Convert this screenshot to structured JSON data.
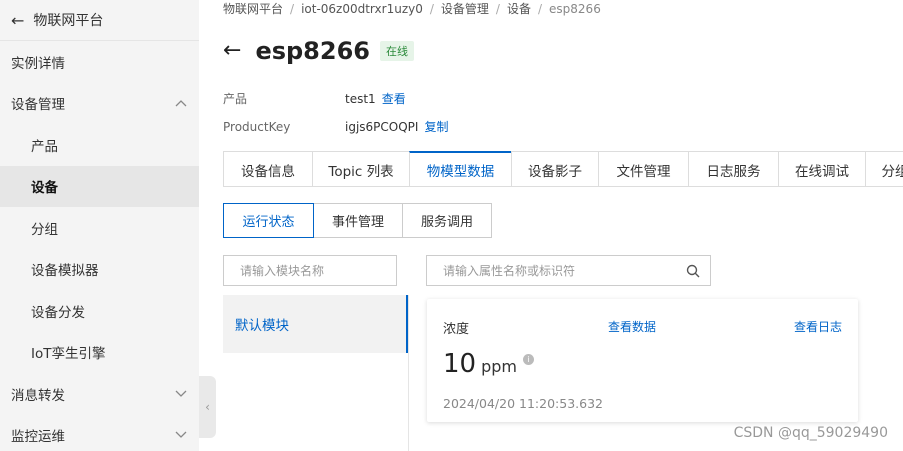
{
  "sidebar": {
    "header": "物联网平台",
    "items": [
      {
        "label": "实例详情",
        "sub": false,
        "active": false,
        "chevron": ""
      },
      {
        "label": "设备管理",
        "sub": false,
        "active": false,
        "chevron": "up"
      },
      {
        "label": "产品",
        "sub": true,
        "active": false,
        "chevron": ""
      },
      {
        "label": "设备",
        "sub": true,
        "active": true,
        "chevron": ""
      },
      {
        "label": "分组",
        "sub": true,
        "active": false,
        "chevron": ""
      },
      {
        "label": "设备模拟器",
        "sub": true,
        "active": false,
        "chevron": ""
      },
      {
        "label": "设备分发",
        "sub": true,
        "active": false,
        "chevron": ""
      },
      {
        "label": "IoT孪生引擎",
        "sub": true,
        "active": false,
        "chevron": ""
      },
      {
        "label": "消息转发",
        "sub": false,
        "active": false,
        "chevron": "down"
      },
      {
        "label": "监控运维",
        "sub": false,
        "active": false,
        "chevron": "down"
      }
    ]
  },
  "breadcrumb": [
    "物联网平台",
    "iot-06z00dtrxr1uzy0",
    "设备管理",
    "设备",
    "esp8266"
  ],
  "device": {
    "name": "esp8266",
    "status": "在线"
  },
  "meta": {
    "product_key_label": "产品",
    "product_value": "test1",
    "product_link": "查看",
    "pk_key_label": "ProductKey",
    "pk_value": "igjs6PCOQPI",
    "pk_link": "复制"
  },
  "tabs": [
    {
      "label": "设备信息",
      "active": false
    },
    {
      "label": "Topic 列表",
      "active": false
    },
    {
      "label": "物模型数据",
      "active": true
    },
    {
      "label": "设备影子",
      "active": false
    },
    {
      "label": "文件管理",
      "active": false
    },
    {
      "label": "日志服务",
      "active": false
    },
    {
      "label": "在线调试",
      "active": false
    },
    {
      "label": "分组",
      "active": false
    }
  ],
  "subtabs": [
    {
      "label": "运行状态",
      "active": true
    },
    {
      "label": "事件管理",
      "active": false
    },
    {
      "label": "服务调用",
      "active": false
    }
  ],
  "module_search": {
    "placeholder": "请输入模块名称"
  },
  "property_search": {
    "placeholder": "请输入属性名称或标识符"
  },
  "modules": [
    {
      "label": "默认模块",
      "active": true
    }
  ],
  "property_card": {
    "name": "浓度",
    "view_data_link": "查看数据",
    "view_log_link": "查看日志",
    "value": "10",
    "unit": "ppm",
    "timestamp": "2024/04/20 11:20:53.632"
  },
  "watermark": "CSDN @qq_59029490",
  "colors": {
    "accent": "#0064c8",
    "status_bg": "#e6f4e8",
    "status_text": "#2a8a3a",
    "sidebar_bg": "#f4f4f4"
  }
}
